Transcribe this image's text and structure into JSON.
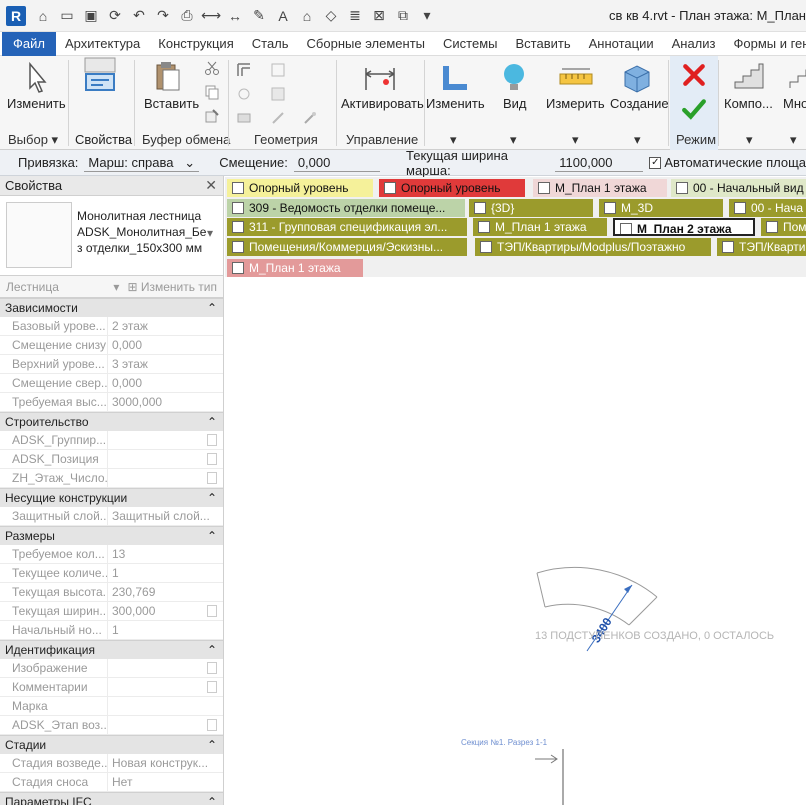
{
  "app": {
    "logo": "R",
    "title": "св кв 4.rvt - План этажа: М_План"
  },
  "menu": [
    "Файл",
    "Архитектура",
    "Конструкция",
    "Сталь",
    "Сборные элементы",
    "Системы",
    "Вставить",
    "Аннотации",
    "Анализ",
    "Формы и генплан"
  ],
  "ribbon": {
    "buttons": {
      "modify": "Изменить",
      "paste": "Вставить",
      "activate": "Активировать",
      "edit": "Изменить",
      "view": "Вид",
      "measure": "Измерить",
      "create": "Создание",
      "component": "Компо...",
      "multi": "Мно"
    },
    "groups": {
      "select": "Выбор",
      "properties": "Свойства",
      "clipboard": "Буфер обмена",
      "geometry": "Геометрия",
      "manage": "Управление",
      "mode": "Режим"
    }
  },
  "options": {
    "location_label": "Привязка:",
    "location_value": "Марш: справа",
    "offset_label": "Смещение:",
    "offset_value": "0,000",
    "width_label": "Текущая ширина марша:",
    "width_value": "1100,000",
    "auto_label": "Автоматические площа"
  },
  "properties": {
    "title": "Свойства",
    "type_name": "Монолитная лестница ADSK_Монолитная_Бе з отделки_150x300 мм",
    "filter": "Лестница",
    "edit_type": "Изменить тип",
    "sections": [
      {
        "name": "Зависимости",
        "rows": [
          [
            "Базовый урове...",
            "2 этаж"
          ],
          [
            "Смещение снизу",
            "0,000"
          ],
          [
            "Верхний урове...",
            "3 этаж"
          ],
          [
            "Смещение свер...",
            "0,000"
          ],
          [
            "Требуемая выс...",
            "3000,000"
          ]
        ]
      },
      {
        "name": "Строительство",
        "rows": [
          [
            "ADSK_Группир...",
            ""
          ],
          [
            "ADSK_Позиция",
            ""
          ],
          [
            "ZH_Этаж_Число...",
            ""
          ]
        ]
      },
      {
        "name": "Несущие конструкции",
        "rows": [
          [
            "Защитный слой...",
            "Защитный слой..."
          ]
        ]
      },
      {
        "name": "Размеры",
        "rows": [
          [
            "Требуемое кол...",
            "13"
          ],
          [
            "Текущее количе...",
            "1"
          ],
          [
            "Текущая высота...",
            "230,769"
          ],
          [
            "Текущая ширин...",
            "300,000"
          ],
          [
            "Начальный но...",
            "1"
          ]
        ]
      },
      {
        "name": "Идентификация",
        "rows": [
          [
            "Изображение",
            ""
          ],
          [
            "Комментарии",
            ""
          ],
          [
            "Марка",
            ""
          ],
          [
            "ADSK_Этап воз...",
            ""
          ]
        ]
      },
      {
        "name": "Стадии",
        "rows": [
          [
            "Стадия возведе...",
            "Новая конструк..."
          ],
          [
            "Стадия сноса",
            "Нет"
          ]
        ]
      },
      {
        "name": "Параметры IFC",
        "rows": []
      }
    ]
  },
  "tabs": [
    {
      "label": "Опорный уровень",
      "bg": "#f5f19a"
    },
    {
      "label": "Опорный уровень",
      "bg": "#e03a3a"
    },
    {
      "label": "М_План 1 этажа",
      "bg": "#f0d7d7"
    },
    {
      "label": "00 - Начальный вид",
      "bg": "#dfe8c8"
    },
    {
      "label": "309 - Ведомость отделки помеще...",
      "bg": "#bcd3a8"
    },
    {
      "label": "{3D}",
      "bg": "#9b9b2c"
    },
    {
      "label": "М_3D",
      "bg": "#9b9b2c"
    },
    {
      "label": "00 - Нача",
      "bg": "#9b9b2c"
    },
    {
      "label": "311 - Групповая спецификация эл...",
      "bg": "#9b9b2c"
    },
    {
      "label": "М_План 1 этажа",
      "bg": "#9b9b2c"
    },
    {
      "label": "М_План 2 этажа",
      "bg": "#9b9b2c"
    },
    {
      "label": "Пом",
      "bg": "#9b9b2c"
    },
    {
      "label": "Помещения/Коммерция/Эскизны...",
      "bg": "#9b9b2c"
    },
    {
      "label": "ТЭП/Квартиры/Modplus/Поэтажно",
      "bg": "#9b9b2c"
    },
    {
      "label": "ТЭП/Квартир",
      "bg": "#9b9b2c"
    },
    {
      "label": "М_План 1 этажа",
      "bg": "#e39a9a"
    }
  ],
  "canvas": {
    "dimension": "3400",
    "status": "13 ПОДСТУПЕНКОВ СОЗДАНО, 0 ОСТАЛОСЬ",
    "section_label": "Секция №1. Разрез 1-1"
  }
}
